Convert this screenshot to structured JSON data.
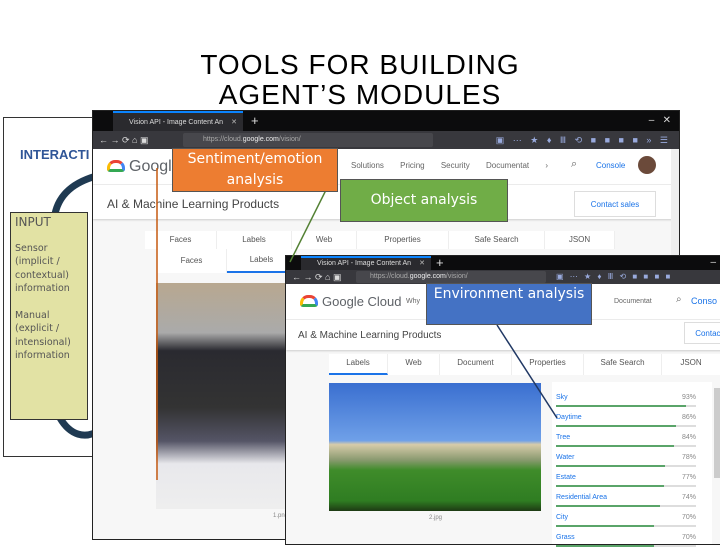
{
  "title": "TOOLS FOR BUILDING AGENT’S MODULES",
  "left_panel": {
    "heading": "INTERACTI",
    "input_title": "INPUT",
    "sensor": "Sensor (implicit / contextual) information",
    "manual": "Manual (explicit / intensional) information"
  },
  "browser1": {
    "tab_title": "Vision API - Image Content An",
    "url_prefix": "https://cloud.",
    "url_domain": "google.com",
    "url_path": "/vision/",
    "logo": "Google",
    "nav": [
      "Solutions",
      "Pricing",
      "Security",
      "Documentat",
      "›"
    ],
    "console": "Console",
    "subheader": "AI & Machine Learning Products",
    "contact": "Contact sales",
    "tabs_back": [
      "Faces",
      "Labels",
      "Web",
      "Properties",
      "Safe Search",
      "JSON"
    ],
    "tabs_front": [
      "Faces",
      "Labels"
    ],
    "caption": "1.png"
  },
  "browser2": {
    "tab_title": "Vision API - Image Content An",
    "url_prefix": "https://cloud.",
    "url_domain": "google.com",
    "url_path": "/vision/",
    "logo": "Google Cloud",
    "nav_first": "Why G",
    "nav_last": "Documentat",
    "console": "Conso",
    "subheader": "AI & Machine Learning Products",
    "contact": "Contact",
    "tabs": [
      "Labels",
      "Web",
      "Document",
      "Properties",
      "Safe Search",
      "JSON"
    ],
    "caption": "2.jpg",
    "labels": [
      {
        "name": "Sky",
        "pct": 93
      },
      {
        "name": "Daytime",
        "pct": 86
      },
      {
        "name": "Tree",
        "pct": 84
      },
      {
        "name": "Water",
        "pct": 78
      },
      {
        "name": "Estate",
        "pct": 77
      },
      {
        "name": "Residential Area",
        "pct": 74
      },
      {
        "name": "City",
        "pct": 70
      },
      {
        "name": "Grass",
        "pct": 70
      }
    ]
  },
  "callouts": {
    "sentiment": "Sentiment/emotion analysis",
    "object": "Object analysis",
    "environment": "Environment analysis"
  },
  "colors": {
    "orange": "#ed7d31",
    "green": "#70ad47",
    "blue": "#4472c4"
  }
}
